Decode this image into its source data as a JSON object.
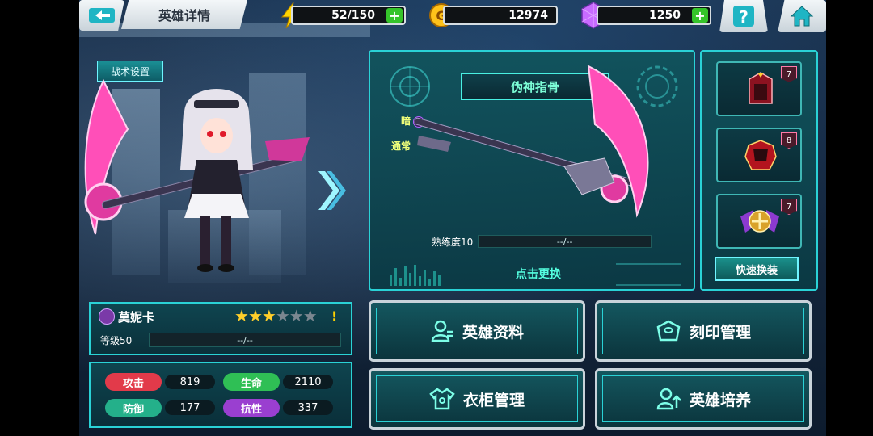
{
  "topbar": {
    "title": "英雄详情",
    "energy": "52/150",
    "gold": "12974",
    "gems": "1250",
    "plus_label": "+"
  },
  "tactics_label": "战术设置",
  "weapon": {
    "name": "伪神指骨",
    "element_label": "暗",
    "type_label": "通常",
    "proficiency_label": "熟练度10",
    "proficiency_value": "--/--",
    "swap_label": "点击更换"
  },
  "equipment": {
    "slots": [
      {
        "level": "7",
        "icon": "crimson-helmet-icon"
      },
      {
        "level": "8",
        "icon": "armor-chest-icon"
      },
      {
        "level": "7",
        "icon": "winged-emblem-icon"
      }
    ],
    "quick_swap_label": "快速换装"
  },
  "hero": {
    "name": "莫妮卡",
    "stars_filled": 3,
    "stars_total": 6,
    "warning": "!",
    "level_label": "等级50",
    "exp_value": "--/--"
  },
  "stats": [
    {
      "label": "攻击",
      "value": "819",
      "color": "#e23a4a"
    },
    {
      "label": "生命",
      "value": "2110",
      "color": "#2fbf55"
    },
    {
      "label": "防御",
      "value": "177",
      "color": "#24b08a"
    },
    {
      "label": "抗性",
      "value": "337",
      "color": "#9a3fd0"
    }
  ],
  "actions": [
    {
      "label": "英雄资料",
      "icon": "profile-icon"
    },
    {
      "label": "刻印管理",
      "icon": "engrave-icon"
    },
    {
      "label": "衣柜管理",
      "icon": "wardrobe-icon"
    },
    {
      "label": "英雄培养",
      "icon": "training-icon"
    }
  ],
  "colors": {
    "accent": "#2ad2d6",
    "name_text": "#7dffd8",
    "element_text": "#f0ff7a",
    "plus_green": "#35c42a",
    "star": "#ffcf2a"
  }
}
